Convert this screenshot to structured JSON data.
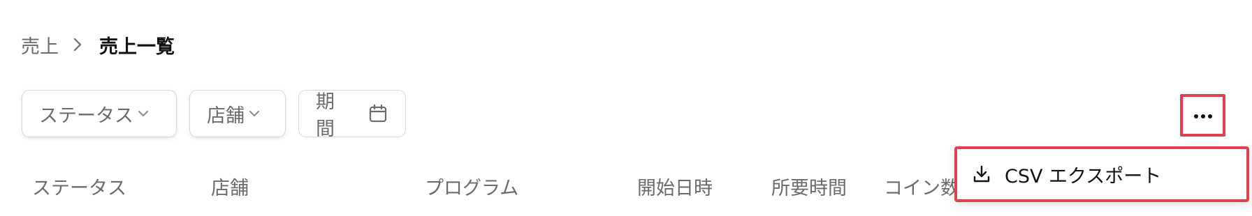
{
  "breadcrumb": {
    "parent": "売上",
    "current": "売上一覧",
    "separator_icon": "chevron-right-icon"
  },
  "filters": {
    "status_label": "ステータス",
    "store_label": "店舗",
    "period_label": "期間",
    "period_icon": "calendar-icon",
    "dropdown_icon": "chevron-down-icon"
  },
  "more_menu": {
    "icon": "ellipsis-icon",
    "items": [
      {
        "label": "CSV エクスポート",
        "icon": "download-icon"
      }
    ]
  },
  "table": {
    "columns": [
      "ステータス",
      "店舗",
      "プログラム",
      "開始日時",
      "所要時間",
      "コイン数"
    ]
  },
  "colors": {
    "highlight": "#e0414e",
    "muted_text": "#6b6b6b",
    "border": "#d9d9d9"
  }
}
